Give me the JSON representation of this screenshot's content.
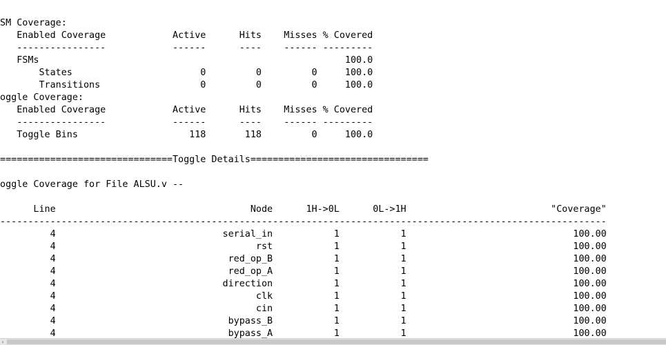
{
  "report": {
    "lines": [
      "FSM Coverage:",
      "    Enabled Coverage            Active      Hits    Misses % Covered",
      "    ----------------            ------      ----    ------ ---------",
      "    FSMs                                                       100.0",
      "        States                       0         0         0     100.0",
      "        Transitions                  0         0         0     100.0",
      "Toggle Coverage:",
      "    Enabled Coverage            Active      Hits    Misses % Covered",
      "    ----------------            ------      ----    ------ ---------",
      "    Toggle Bins                    118       118         0     100.0",
      "",
      "================================Toggle Details================================",
      "",
      "Toggle Coverage for File ALSU.v --",
      "",
      "       Line                                   Node      1H->0L      0L->1H                          \"Coverage\"",
      "--------------------------------------------------------------------------------------------------------------",
      "          4                              serial_in           1           1                              100.00",
      "          4                                    rst           1           1                              100.00",
      "          4                               red_op_B           1           1                              100.00",
      "          4                               red_op_A           1           1                              100.00",
      "          4                              direction           1           1                              100.00",
      "          4                                    clk           1           1                              100.00",
      "          4                                    cin           1           1                              100.00",
      "          4                               bypass_B           1           1                              100.00",
      "          4                               bypass_A           1           1                              100.00"
    ]
  },
  "scrollbar": {
    "left_arrow": "‹"
  }
}
